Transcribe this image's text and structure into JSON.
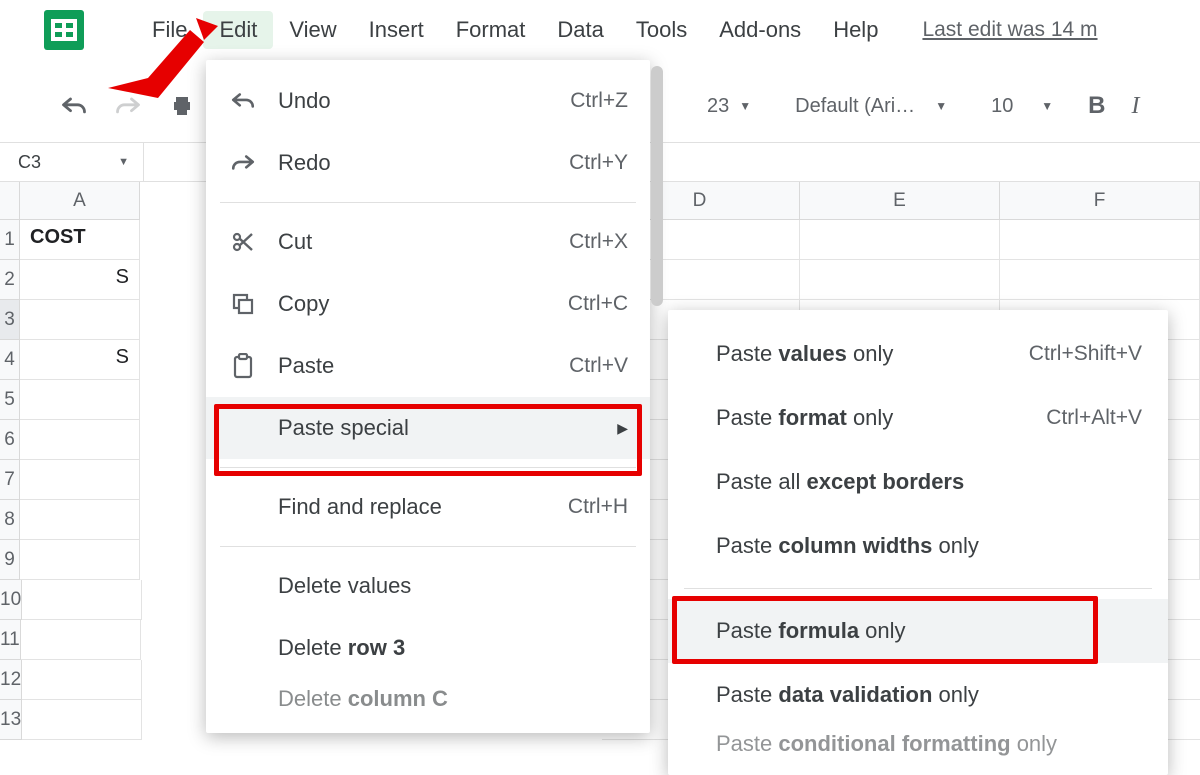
{
  "menu": {
    "items": [
      "File",
      "Edit",
      "View",
      "Insert",
      "Format",
      "Data",
      "Tools",
      "Add-ons",
      "Help"
    ],
    "active_index": 1,
    "last_edit_text": "Last edit was 14 m"
  },
  "toolbar": {
    "zoom_value": "23",
    "font_name": "Default (Ari…",
    "font_size": "10"
  },
  "namebox": {
    "cell_ref": "C3"
  },
  "columns": [
    "A",
    "D",
    "E",
    "F"
  ],
  "rows": [
    {
      "num": "1",
      "A": "COST"
    },
    {
      "num": "2",
      "A": "S"
    },
    {
      "num": "3",
      "A": "",
      "selected": true
    },
    {
      "num": "4",
      "A": "S"
    },
    {
      "num": "5",
      "A": ""
    },
    {
      "num": "6",
      "A": ""
    },
    {
      "num": "7",
      "A": ""
    },
    {
      "num": "8",
      "A": ""
    },
    {
      "num": "9",
      "A": ""
    },
    {
      "num": "10",
      "A": ""
    },
    {
      "num": "11",
      "A": ""
    },
    {
      "num": "12",
      "A": ""
    },
    {
      "num": "13",
      "A": ""
    }
  ],
  "edit_menu": {
    "undo": {
      "label": "Undo",
      "shortcut": "Ctrl+Z"
    },
    "redo": {
      "label": "Redo",
      "shortcut": "Ctrl+Y"
    },
    "cut": {
      "label": "Cut",
      "shortcut": "Ctrl+X"
    },
    "copy": {
      "label": "Copy",
      "shortcut": "Ctrl+C"
    },
    "paste": {
      "label": "Paste",
      "shortcut": "Ctrl+V"
    },
    "paste_special": {
      "label": "Paste special"
    },
    "find_replace": {
      "label": "Find and replace",
      "shortcut": "Ctrl+H"
    },
    "delete_values": {
      "label": "Delete values"
    },
    "delete_row": {
      "label_prefix": "Delete ",
      "label_bold": "row 3"
    },
    "delete_col": {
      "label_prefix": "Delete ",
      "label_bold": "column C"
    }
  },
  "paste_special_menu": {
    "values": {
      "pre": "Paste ",
      "bold": "values",
      "post": " only",
      "shortcut": "Ctrl+Shift+V"
    },
    "format": {
      "pre": "Paste ",
      "bold": "format",
      "post": " only",
      "shortcut": "Ctrl+Alt+V"
    },
    "except_borders": {
      "pre": "Paste all ",
      "bold": "except borders",
      "post": ""
    },
    "col_widths": {
      "pre": "Paste ",
      "bold": "column widths",
      "post": " only"
    },
    "formula": {
      "pre": "Paste ",
      "bold": "formula",
      "post": " only"
    },
    "data_validation": {
      "pre": "Paste ",
      "bold": "data validation",
      "post": " only"
    },
    "conditional": {
      "pre": "Paste ",
      "bold": "conditional formatting",
      "post": " only"
    }
  }
}
